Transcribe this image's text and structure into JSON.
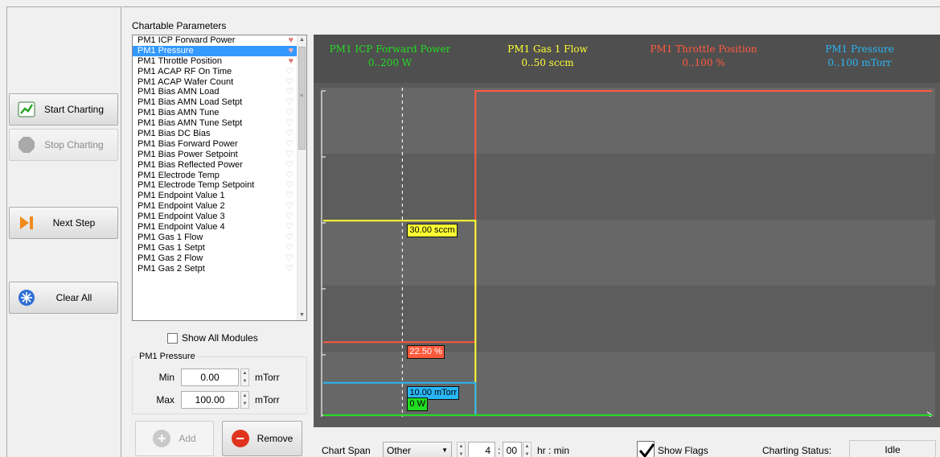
{
  "commands": {
    "start": "Start Charting",
    "stop": "Stop Charting",
    "next": "Next Step",
    "clear": "Clear All"
  },
  "params": {
    "title": "Chartable Parameters",
    "items": [
      {
        "label": "PM1 ICP Forward Power",
        "fav": true,
        "selected": false
      },
      {
        "label": "PM1 Pressure",
        "fav": true,
        "selected": true
      },
      {
        "label": "PM1 Throttle Position",
        "fav": true,
        "selected": false
      },
      {
        "label": "PM1 ACAP RF On Time",
        "fav": false,
        "selected": false
      },
      {
        "label": "PM1 ACAP Wafer Count",
        "fav": false,
        "selected": false
      },
      {
        "label": "PM1 Bias AMN Load",
        "fav": false,
        "selected": false
      },
      {
        "label": "PM1 Bias AMN Load Setpt",
        "fav": false,
        "selected": false
      },
      {
        "label": "PM1 Bias AMN Tune",
        "fav": false,
        "selected": false
      },
      {
        "label": "PM1 Bias AMN Tune Setpt",
        "fav": false,
        "selected": false
      },
      {
        "label": "PM1 Bias DC Bias",
        "fav": false,
        "selected": false
      },
      {
        "label": "PM1 Bias Forward Power",
        "fav": false,
        "selected": false
      },
      {
        "label": "PM1 Bias Power Setpoint",
        "fav": false,
        "selected": false
      },
      {
        "label": "PM1 Bias Reflected Power",
        "fav": false,
        "selected": false
      },
      {
        "label": "PM1 Electrode Temp",
        "fav": false,
        "selected": false
      },
      {
        "label": "PM1 Electrode Temp Setpoint",
        "fav": false,
        "selected": false
      },
      {
        "label": "PM1 Endpoint Value 1",
        "fav": false,
        "selected": false
      },
      {
        "label": "PM1 Endpoint Value 2",
        "fav": false,
        "selected": false
      },
      {
        "label": "PM1 Endpoint Value 3",
        "fav": false,
        "selected": false
      },
      {
        "label": "PM1 Endpoint Value 4",
        "fav": false,
        "selected": false
      },
      {
        "label": "PM1 Gas 1 Flow",
        "fav": false,
        "selected": false
      },
      {
        "label": "PM1 Gas 1 Setpt",
        "fav": false,
        "selected": false
      },
      {
        "label": "PM1 Gas 2 Flow",
        "fav": false,
        "selected": false
      },
      {
        "label": "PM1 Gas 2 Setpt",
        "fav": false,
        "selected": false
      }
    ],
    "show_all_modules": "Show All Modules"
  },
  "range": {
    "group_title": "PM1 Pressure",
    "min_label": "Min",
    "min_value": "0.00",
    "max_label": "Max",
    "max_value": "100.00",
    "unit": "mTorr"
  },
  "actions": {
    "add": "Add",
    "remove": "Remove"
  },
  "chart": {
    "legend": [
      {
        "name": "PM1 ICP Forward Power",
        "range": "0..200 W",
        "color": "#22dd22"
      },
      {
        "name": "PM1 Gas 1 Flow",
        "range": "0..50 sccm",
        "color": "#ffff33"
      },
      {
        "name": "PM1 Throttle Position",
        "range": "0..100 %",
        "color": "#ff5a3c"
      },
      {
        "name": "PM1 Pressure",
        "range": "0..100 mTorr",
        "color": "#29b6f6"
      }
    ],
    "cursor_labels": {
      "gas": "30.00 sccm",
      "throttle": "22.50 %",
      "pressure": "10.00 mTorr",
      "power": "0 W"
    }
  },
  "chart_data": {
    "type": "line",
    "series": [
      {
        "name": "PM1 ICP Forward Power",
        "unit": "W",
        "ymax": 200,
        "color": "#22dd22",
        "points": [
          [
            0,
            0
          ],
          [
            1,
            0
          ]
        ]
      },
      {
        "name": "PM1 Gas 1 Flow",
        "unit": "sccm",
        "ymax": 50,
        "color": "#ffff33",
        "points": [
          [
            0,
            30
          ],
          [
            0.25,
            30
          ],
          [
            0.25,
            0
          ],
          [
            1,
            0
          ]
        ]
      },
      {
        "name": "PM1 Throttle Position",
        "unit": "%",
        "ymax": 100,
        "color": "#ff5a3c",
        "points": [
          [
            0,
            22.5
          ],
          [
            0.25,
            22.5
          ],
          [
            0.25,
            100
          ],
          [
            1,
            100
          ]
        ]
      },
      {
        "name": "PM1 Pressure",
        "unit": "mTorr",
        "ymax": 100,
        "color": "#29b6f6",
        "points": [
          [
            0,
            10
          ],
          [
            0.25,
            10
          ],
          [
            0.25,
            0
          ],
          [
            1,
            0
          ]
        ]
      }
    ],
    "cursor_x": 0.13,
    "cursor_values": [
      "0 W",
      "30.00 sccm",
      "22.50 %",
      "10.00 mTorr"
    ]
  },
  "footer": {
    "chart_span_label": "Chart Span",
    "chart_span_value": "Other",
    "hours": "4",
    "minutes": "00",
    "time_unit": "hr : min",
    "show_flags": "Show Flags",
    "show_flags_checked": true,
    "status_label": "Charting Status:",
    "status_value": "Idle"
  }
}
